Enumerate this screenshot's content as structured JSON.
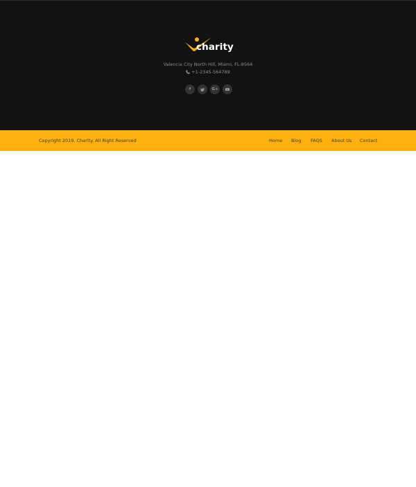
{
  "brand": {
    "name": "charity",
    "accent_color": "#fdb10f",
    "logo_icon": "person-check-icon"
  },
  "footer": {
    "address": "Valencia City North Hill, Miami, FL-8564",
    "phone": "+1-2345-564789",
    "phone_icon": "phone-icon",
    "background_color": "#121212",
    "social": [
      {
        "icon": "facebook-icon",
        "glyph": "f"
      },
      {
        "icon": "twitter-icon",
        "glyph": ""
      },
      {
        "icon": "google-plus-icon",
        "glyph": "G+"
      },
      {
        "icon": "youtube-icon",
        "glyph": ""
      }
    ]
  },
  "bottom_bar": {
    "copyright": "Copyright 2019. Charity. All Right Reserved",
    "nav": [
      "Home",
      "Blog",
      "FAQS",
      "About Us",
      "Contact"
    ]
  }
}
